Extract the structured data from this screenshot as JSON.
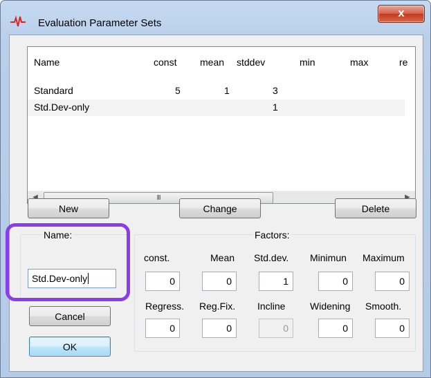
{
  "window": {
    "title": "Evaluation Parameter Sets",
    "close_label": "x",
    "accent": "#8b3ee8"
  },
  "list": {
    "columns": [
      "Name",
      "const",
      "mean",
      "stddev",
      "min",
      "max",
      "re"
    ],
    "rows": [
      [
        "Standard",
        "5",
        "1",
        "3"
      ],
      [
        "Std.Dev-only",
        "",
        "",
        "1"
      ]
    ],
    "scroll_grip": "III"
  },
  "buttons": {
    "new": "New",
    "change": "Change",
    "delete": "Delete",
    "cancel": "Cancel",
    "ok": "OK"
  },
  "name_box": {
    "label": "Name:",
    "value": "Std.Dev-only"
  },
  "factors": {
    "title": "Factors:",
    "row1": [
      {
        "label": "const.",
        "value": "0"
      },
      {
        "label": "Mean",
        "value": "0"
      },
      {
        "label": "Std.dev.",
        "value": "1"
      },
      {
        "label": "Minimun",
        "value": "0"
      },
      {
        "label": "Maximum",
        "value": "0"
      }
    ],
    "row2": [
      {
        "label": "Regress.",
        "value": "0"
      },
      {
        "label": "Reg.Fix.",
        "value": "0"
      },
      {
        "label": "Incline",
        "value": "0"
      },
      {
        "label": "Widening",
        "value": "0"
      },
      {
        "label": "Smooth.",
        "value": "0"
      }
    ]
  }
}
